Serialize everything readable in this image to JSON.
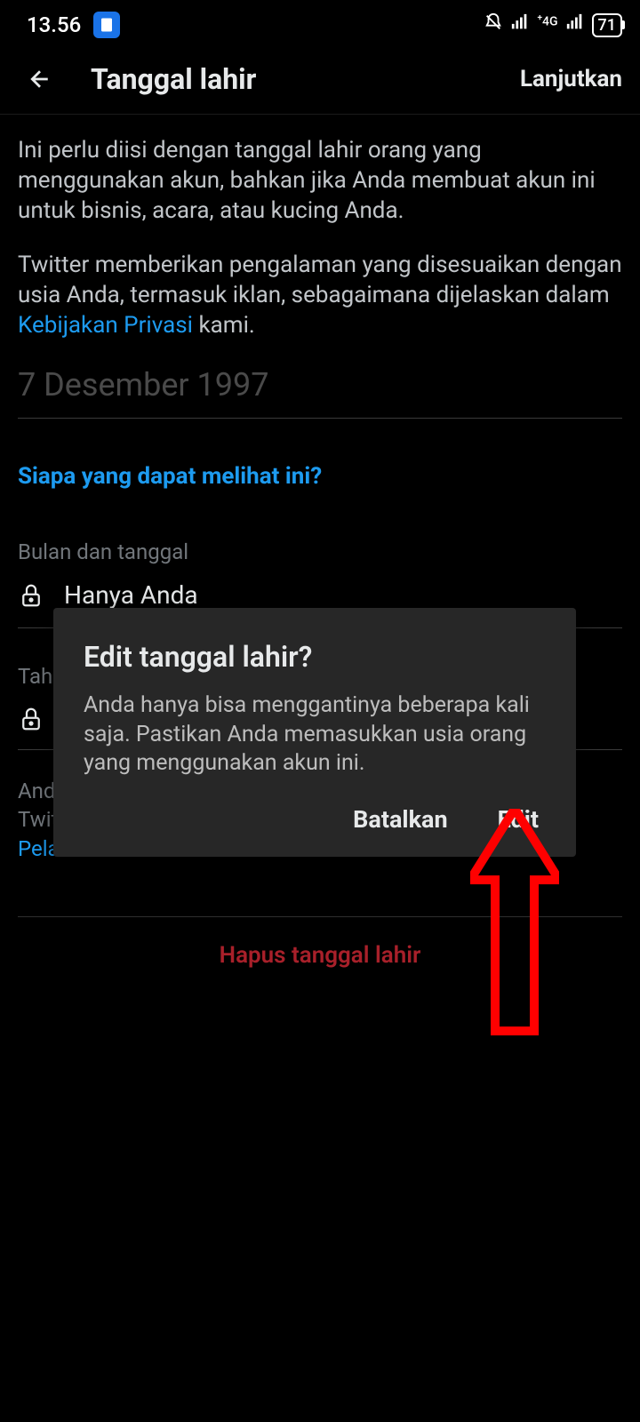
{
  "status": {
    "time": "13.56",
    "battery": "71",
    "network_4g": "4G"
  },
  "header": {
    "title": "Tanggal lahir",
    "next": "Lanjutkan"
  },
  "description": {
    "p1": "Ini perlu diisi dengan tanggal lahir orang yang menggunakan akun, bahkan jika Anda membuat akun ini untuk bisnis, acara, atau kucing Anda.",
    "p2_prefix": "Twitter memberikan pengalaman yang disesuaikan dengan usia Anda, termasuk iklan, sebagaimana dijelaskan dalam ",
    "p2_link": "Kebijakan Privasi",
    "p2_suffix": " kami."
  },
  "date_value": "7 Desember 1997",
  "who_can_see": "Siapa yang dapat melihat ini?",
  "fields": {
    "month_day": {
      "label": "Bulan dan tanggal",
      "value": "Hanya Anda"
    },
    "year": {
      "label": "Tah",
      "value": ""
    }
  },
  "legal": {
    "line1_prefix": "And",
    "line2_prefix": "Twit",
    "link": "Pela"
  },
  "delete_label": "Hapus tanggal lahir",
  "dialog": {
    "title": "Edit tanggal lahir?",
    "body": "Anda hanya bisa menggantinya beberapa kali saja. Pastikan Anda memasukkan usia orang yang menggunakan akun ini.",
    "cancel": "Batalkan",
    "confirm": "Edit"
  }
}
